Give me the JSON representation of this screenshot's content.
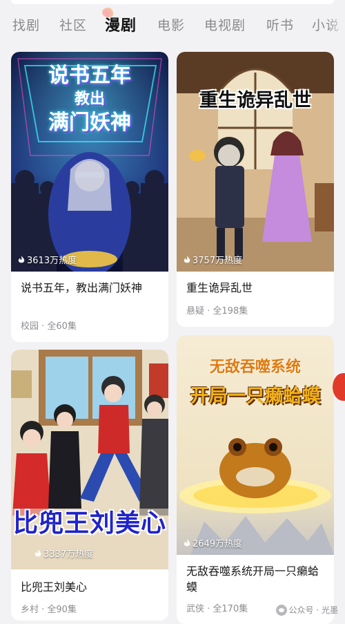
{
  "tabs": [
    "找剧",
    "社区",
    "漫剧",
    "电影",
    "电视剧",
    "听书",
    "小说"
  ],
  "active_tab": "漫剧",
  "cards": [
    {
      "poster_text": [
        "说书五年",
        "教出",
        "满门妖神"
      ],
      "heat": "3613万热度",
      "title": "说书五年，教出满门妖神",
      "meta": "校园 · 全60集",
      "accent": "#1b2a6b"
    },
    {
      "poster_text": [
        "重生诡异乱世"
      ],
      "heat": "3757万热度",
      "title": "重生诡异乱世",
      "meta": "悬疑 · 全198集",
      "accent": "#c9a37a"
    },
    {
      "poster_text": [
        "比兜王刘美心"
      ],
      "heat": "3337万热度",
      "title": "比兜王刘美心",
      "meta": "乡村 · 全90集",
      "accent": "#c1272d"
    },
    {
      "poster_text": [
        "无敌吞噬系统",
        "开局一只癞蛤蟆"
      ],
      "heat": "2649万热度",
      "title": "无敌吞噬系统开局一只癞蛤蟆",
      "meta": "武侠 · 全170集",
      "accent": "#d98a1c"
    }
  ],
  "watermark": "公众号 · 光墨",
  "icons": {
    "heat": "flame-icon",
    "watermark": "wechat-icon"
  }
}
